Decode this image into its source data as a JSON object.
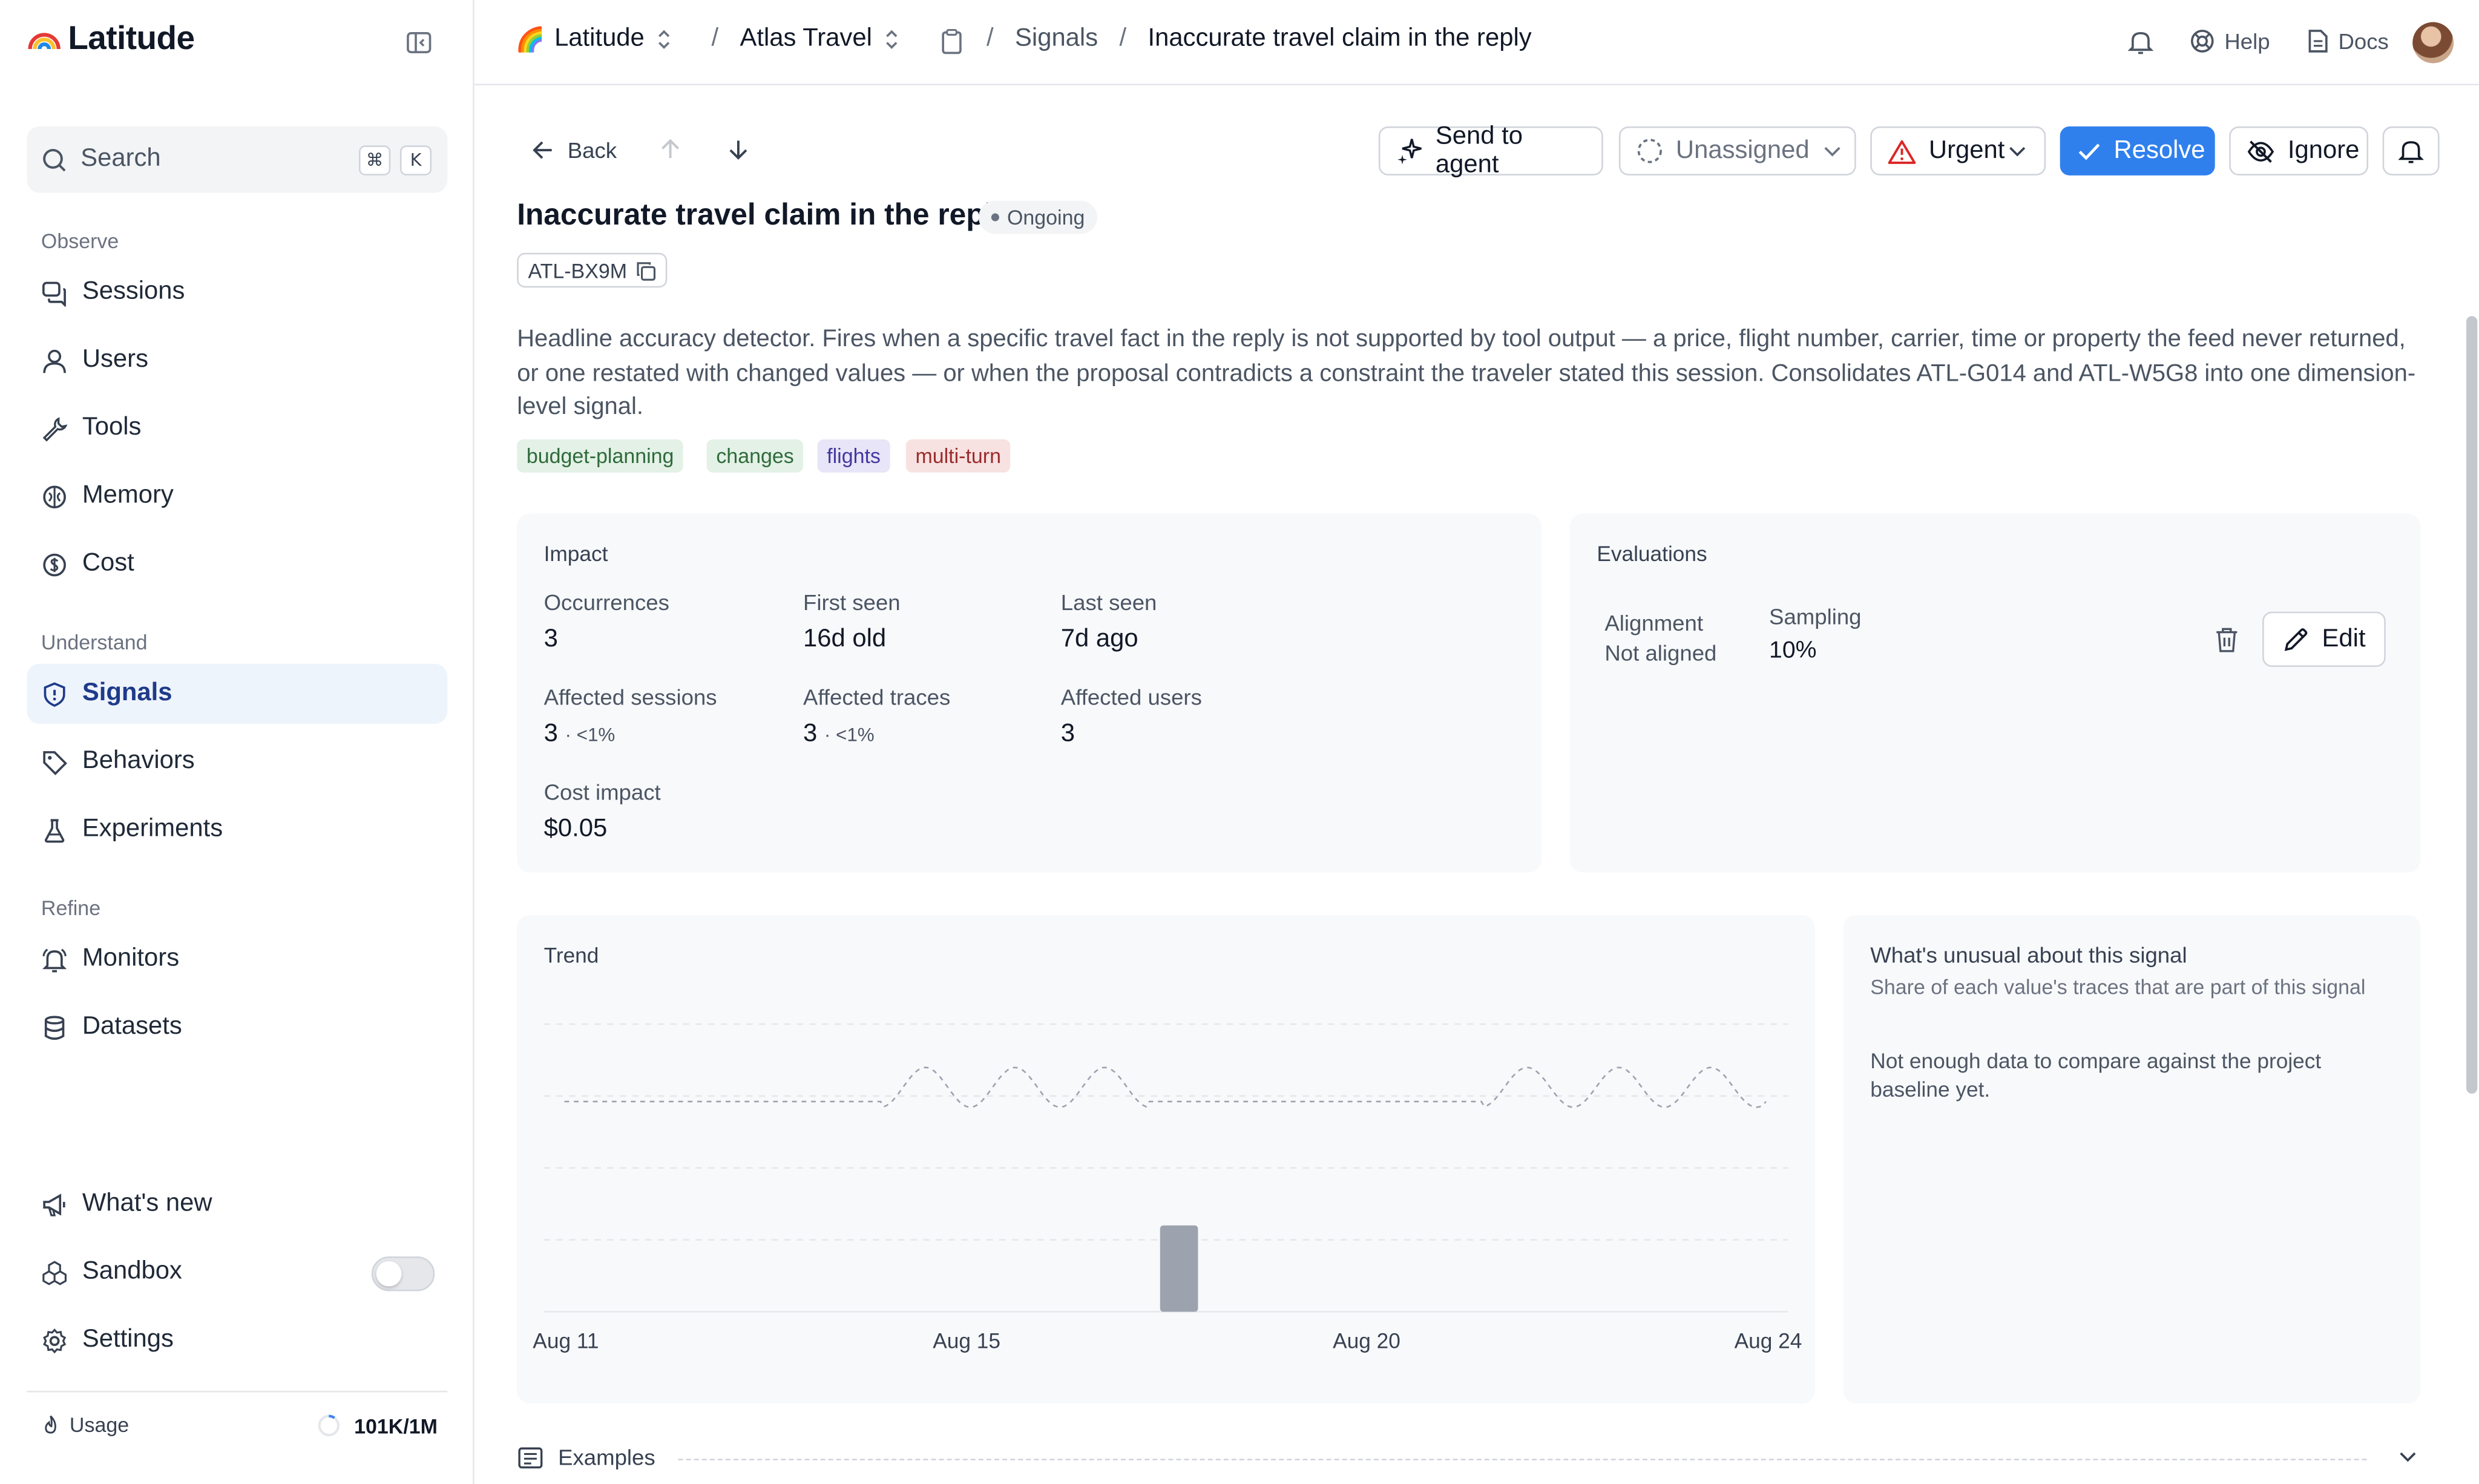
{
  "sidebar": {
    "app_name": "Latitude",
    "search_label": "Search",
    "search_shortcut": [
      "⌘",
      "K"
    ],
    "sections": {
      "observe": "Observe",
      "understand": "Understand",
      "refine": "Refine"
    },
    "items": {
      "sessions": "Sessions",
      "users": "Users",
      "tools": "Tools",
      "memory": "Memory",
      "cost": "Cost",
      "signals": "Signals",
      "behaviors": "Behaviors",
      "experiments": "Experiments",
      "monitors": "Monitors",
      "datasets": "Datasets",
      "whats_new": "What's new",
      "sandbox": "Sandbox",
      "settings": "Settings"
    },
    "sandbox_enabled": false,
    "active_item": "Signals",
    "usage_label": "Usage",
    "usage_value": "101K/1M",
    "usage_fraction": 0.101
  },
  "breadcrumb": {
    "org": "Latitude",
    "project": "Atlas Travel",
    "section": "Signals",
    "current": "Inaccurate travel claim in the reply"
  },
  "topbar": {
    "help": "Help",
    "docs": "Docs"
  },
  "toolbar": {
    "back": "Back",
    "send_to_agent": "Send to agent",
    "assignee": "Unassigned",
    "priority": "Urgent",
    "resolve": "Resolve",
    "ignore": "Ignore"
  },
  "signal": {
    "title": "Inaccurate travel claim in the reply",
    "status": "Ongoing",
    "id": "ATL-BX9M",
    "description": "Headline accuracy detector. Fires when a specific travel fact in the reply is not supported by tool output — a price, flight number, carrier, time or property the feed never returned, or one restated with changed values — or when the proposal contradicts a constraint the traveler stated this session. Consolidates ATL-G014 and ATL-W5G8 into one dimension-level signal.",
    "tags": [
      {
        "label": "budget-planning",
        "bg": "#e3f1e6",
        "fg": "#2f6b3b"
      },
      {
        "label": "changes",
        "bg": "#e3f1e6",
        "fg": "#2f6b3b"
      },
      {
        "label": "flights",
        "bg": "#e7e5f7",
        "fg": "#4338a0"
      },
      {
        "label": "multi-turn",
        "bg": "#f8e1e1",
        "fg": "#9b2c2c"
      }
    ]
  },
  "impact": {
    "title": "Impact",
    "occurrences_label": "Occurrences",
    "occurrences": "3",
    "first_seen_label": "First seen",
    "first_seen": "16d old",
    "last_seen_label": "Last seen",
    "last_seen": "7d ago",
    "affected_sessions_label": "Affected sessions",
    "affected_sessions": "3",
    "affected_sessions_pct": "· <1%",
    "affected_traces_label": "Affected traces",
    "affected_traces": "3",
    "affected_traces_pct": "· <1%",
    "affected_users_label": "Affected users",
    "affected_users": "3",
    "cost_impact_label": "Cost impact",
    "cost_impact": "$0.05"
  },
  "evaluations": {
    "title": "Evaluations",
    "alignment_label": "Alignment",
    "alignment_value": "Not aligned",
    "sampling_label": "Sampling",
    "sampling_value": "10%",
    "edit": "Edit"
  },
  "trend": {
    "title": "Trend",
    "x_ticks": [
      "Aug 11",
      "Aug 15",
      "Aug 20",
      "Aug 24"
    ]
  },
  "unusual": {
    "title": "What's unusual about this signal",
    "subtitle": "Share of each value's traces that are part of this signal",
    "body": "Not enough data to compare against the project baseline yet."
  },
  "examples": {
    "label": "Examples"
  },
  "chart_data": {
    "type": "bar",
    "x_start": "Aug 11",
    "x_end": "Aug 24",
    "categories": [
      "Aug 11",
      "Aug 12",
      "Aug 13",
      "Aug 14",
      "Aug 15",
      "Aug 16",
      "Aug 17",
      "Aug 18",
      "Aug 19",
      "Aug 20",
      "Aug 21",
      "Aug 22",
      "Aug 23",
      "Aug 24"
    ],
    "values": [
      0,
      0,
      0,
      0,
      0,
      0,
      3,
      0,
      0,
      0,
      0,
      0,
      0,
      0
    ],
    "grid": true,
    "legend": "none"
  }
}
